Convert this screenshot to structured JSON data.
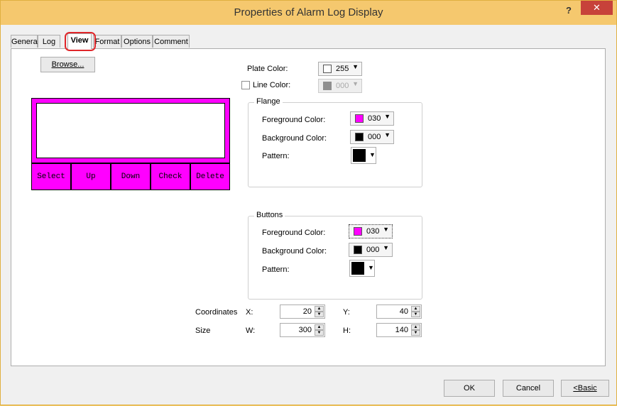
{
  "window": {
    "title": "Properties of Alarm Log Display",
    "help": "?",
    "close": "✕"
  },
  "tabs": [
    {
      "label": "General"
    },
    {
      "label": "Log"
    },
    {
      "label": "View"
    },
    {
      "label": "Format"
    },
    {
      "label": "Options"
    },
    {
      "label": "Comment"
    }
  ],
  "view": {
    "browse": "Browse...",
    "plate_color_label": "Plate Color:",
    "plate_color_value": "255",
    "line_color_label": "Line Color:",
    "line_color_value": "000",
    "flange": {
      "title": "Flange",
      "fg_label": "Foreground Color:",
      "fg_value": "030",
      "bg_label": "Background Color:",
      "bg_value": "000",
      "pattern_label": "Pattern:"
    },
    "buttons_group": {
      "title": "Buttons",
      "fg_label": "Foreground Color:",
      "fg_value": "030",
      "bg_label": "Background Color:",
      "bg_value": "000",
      "pattern_label": "Pattern:"
    },
    "preview_buttons": [
      "Select",
      "Up",
      "Down",
      "Check",
      "Delete"
    ],
    "coordinates_label": "Coordinates",
    "size_label": "Size",
    "x_label": "X:",
    "y_label": "Y:",
    "w_label": "W:",
    "h_label": "H:",
    "x": "20",
    "y": "40",
    "w": "300",
    "h": "140"
  },
  "footer": {
    "ok": "OK",
    "cancel": "Cancel",
    "basic": "<Basic"
  },
  "colors": {
    "magenta": "#ff00ff",
    "black": "#000000",
    "white": "#ffffff",
    "title_bar": "#f5c86e",
    "close_button": "#c7423a",
    "highlight_ring": "#e0262a"
  }
}
